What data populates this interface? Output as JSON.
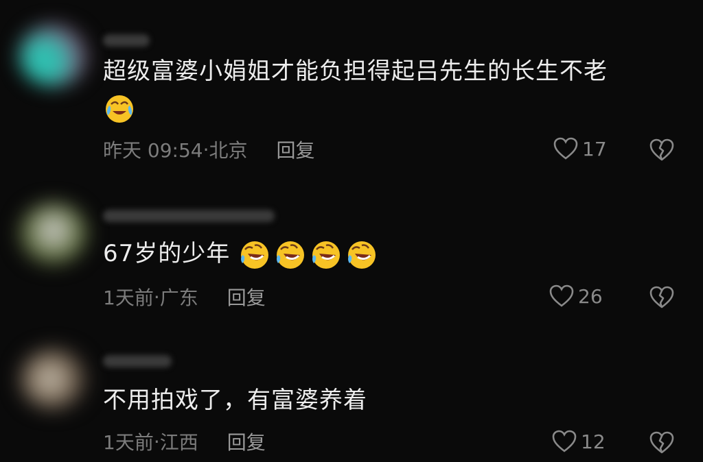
{
  "colors": {
    "background": "#0a0a0a",
    "text": "#ededed",
    "meta": "#7c7c7c",
    "emoji_yellow": "#f7c325"
  },
  "comments": [
    {
      "avatar_colors": [
        "#2fbfb0",
        "#8a6b8e"
      ],
      "text": "超级富婆小娟姐才能负担得起吕先生的长生不老",
      "emojis": [
        "laugh-cry-icon"
      ],
      "time": "昨天 09:54",
      "location": "北京",
      "reply_label": "回复",
      "likes": "17"
    },
    {
      "avatar_colors": [
        "#6f7a5a",
        "#d7d7d7"
      ],
      "text": "67岁的少年",
      "emojis": [
        "rofl-icon",
        "rofl-icon",
        "rofl-icon",
        "rofl-icon"
      ],
      "time": "1天前",
      "location": "广东",
      "reply_label": "回复",
      "likes": "26"
    },
    {
      "avatar_colors": [
        "#8a7a66",
        "#c9c2b5"
      ],
      "text": "不用拍戏了，有富婆养着",
      "emojis": [],
      "time": "1天前",
      "location": "江西",
      "reply_label": "回复",
      "likes": "12"
    }
  ]
}
